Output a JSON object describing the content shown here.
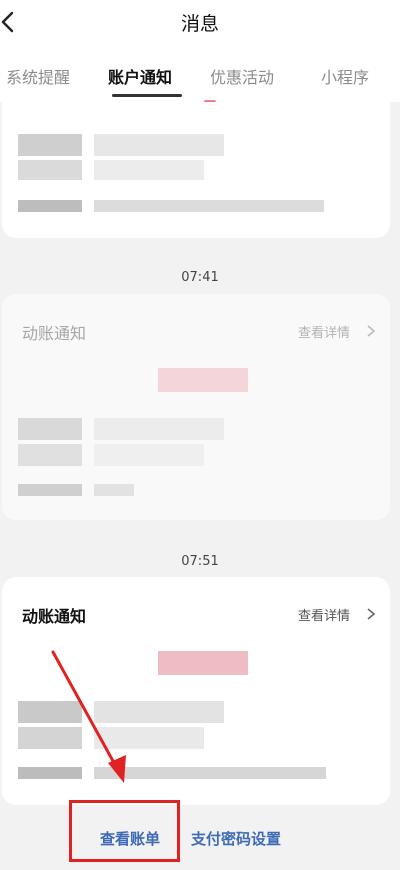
{
  "header": {
    "title": "消息",
    "back_icon": "chevron-left-icon"
  },
  "tabs": [
    {
      "label": "系统提醒",
      "active": false
    },
    {
      "label": "账户通知",
      "active": true
    },
    {
      "label": "优惠活动",
      "active": false
    },
    {
      "label": "小程序",
      "active": false
    }
  ],
  "messages": [
    {
      "time": "07:41",
      "title": "动账通知",
      "detail_label": "查看详情"
    },
    {
      "time": "07:51",
      "title": "动账通知",
      "detail_label": "查看详情"
    }
  ],
  "footer": {
    "view_bill": "查看账单",
    "pay_password": "支付密码设置"
  },
  "colors": {
    "link": "#3e6bb6",
    "highlight": "#e02222"
  }
}
